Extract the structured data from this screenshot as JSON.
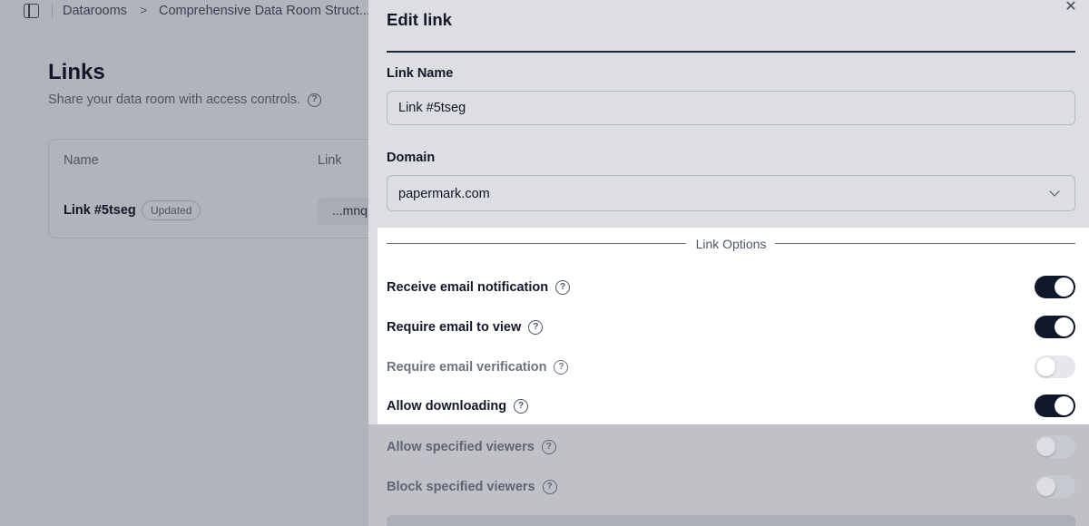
{
  "breadcrumb": {
    "items": [
      "Datarooms",
      "Comprehensive Data Room Struct..."
    ],
    "separator": ">"
  },
  "page": {
    "title": "Links",
    "subtitle": "Share your data room with access controls."
  },
  "table": {
    "headers": [
      "Name",
      "Link"
    ],
    "rows": [
      {
        "name": "Link #5tseg",
        "badge": "Updated",
        "link": "...mnq"
      }
    ]
  },
  "sheet": {
    "title": "Edit link",
    "close_icon": "close-icon",
    "link_name_label": "Link Name",
    "link_name_value": "Link #5tseg",
    "domain_label": "Domain",
    "domain_value": "papermark.com",
    "options_label": "Link Options",
    "options": [
      {
        "label": "Receive email notification",
        "enabled": true,
        "muted": false
      },
      {
        "label": "Require email to view",
        "enabled": true,
        "muted": false
      },
      {
        "label": "Require email verification",
        "enabled": false,
        "muted": true
      },
      {
        "label": "Allow downloading",
        "enabled": true,
        "muted": false
      },
      {
        "label": "Allow specified viewers",
        "enabled": false,
        "muted": true
      },
      {
        "label": "Block specified viewers",
        "enabled": false,
        "muted": true
      }
    ]
  },
  "colors": {
    "toggle_on": "#0f172a",
    "toggle_off": "#e5e7eb",
    "overlay": "rgba(15, 23, 42, 0.32)"
  }
}
